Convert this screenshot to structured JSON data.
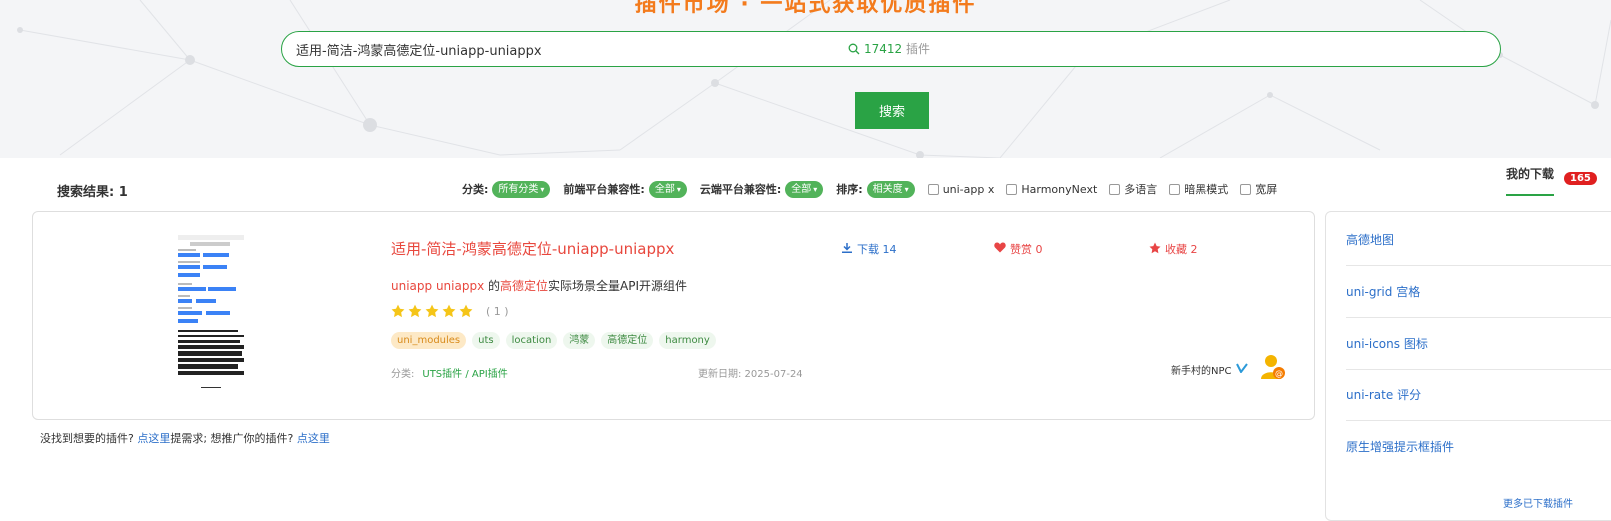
{
  "hero": {
    "title": "插件市场 · 一站式获取优质插件"
  },
  "search": {
    "value": "适用-简洁-鸿蒙高德定位-uniapp-uniappx",
    "plugin_count": "17412",
    "plugin_unit": "插件",
    "button_label": "搜索"
  },
  "results": {
    "label": "搜索结果: 1"
  },
  "filters": {
    "category_label": "分类:",
    "category_value": "所有分类",
    "frontend_label": "前端平台兼容性:",
    "frontend_value": "全部",
    "cloud_label": "云端平台兼容性:",
    "cloud_value": "全部",
    "sort_label": "排序:",
    "sort_value": "相关度",
    "checkboxes": [
      "uni-app x",
      "HarmonyNext",
      "多语言",
      "暗黑模式",
      "宽屏"
    ]
  },
  "plugin": {
    "title": "适用-简洁-鸿蒙高德定位-uniapp-uniappx",
    "downloads": "下载 14",
    "likes": "赞赏 0",
    "favorites": "收藏 2",
    "desc_part1": "uniapp uniappx",
    "desc_part2": " 的",
    "desc_part3": "高德定位",
    "desc_part4": "实际场景全量API开源组件",
    "rating": 5,
    "rating_count": "( 1 )",
    "tags": [
      "uni_modules",
      "uts",
      "location",
      "鸿蒙",
      "高德定位",
      "harmony"
    ],
    "category_label": "分类:",
    "category_value": "UTS插件 / API插件",
    "updated": "更新日期: 2025-07-24",
    "author": "新手村的NPC"
  },
  "bottom_note": {
    "part1": "没找到想要的插件? ",
    "link1": "点这里",
    "part2": "提需求; 想推广你的插件? ",
    "link2": "点这里"
  },
  "sidebar": {
    "tab_label": "我的下载",
    "badge": "165",
    "items": [
      "高德地图",
      "uni-grid 宫格",
      "uni-icons 图标",
      "uni-rate 评分",
      "原生增强提示框插件"
    ],
    "more": "更多已下载插件"
  },
  "colors": {
    "accent_green": "#2aa345",
    "title_red": "#e8473d",
    "link_blue": "#2c6fc9",
    "badge_red": "#e02020"
  }
}
